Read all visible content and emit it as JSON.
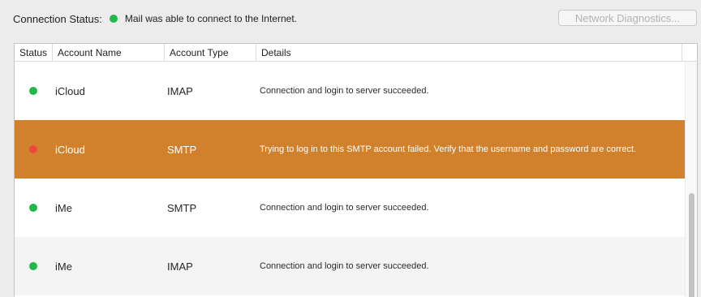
{
  "connection_status": {
    "label": "Connection Status:",
    "indicator_color": "#1fb84a",
    "message": "Mail was able to connect to the Internet."
  },
  "toolbar": {
    "diagnostics_label": "Network Diagnostics..."
  },
  "table": {
    "columns": [
      "Status",
      "Account Name",
      "Account Type",
      "Details"
    ],
    "rows": [
      {
        "status": "ok",
        "status_color": "#1fb84a",
        "account_name": "iCloud",
        "account_type": "IMAP",
        "details": "Connection and login to server succeeded."
      },
      {
        "status": "error",
        "status_color": "#f0463f",
        "account_name": "iCloud",
        "account_type": "SMTP",
        "details": "Trying to log in to this SMTP account failed. Verify that the username and password are correct.",
        "selected": true
      },
      {
        "status": "ok",
        "status_color": "#1fb84a",
        "account_name": "iMe",
        "account_type": "SMTP",
        "details": "Connection and login to server succeeded."
      },
      {
        "status": "ok",
        "status_color": "#1fb84a",
        "account_name": "iMe",
        "account_type": "IMAP",
        "details": "Connection and login to server succeeded."
      }
    ]
  },
  "colors": {
    "selection": "#d1812b",
    "ok": "#1fb84a",
    "error": "#f0463f"
  }
}
